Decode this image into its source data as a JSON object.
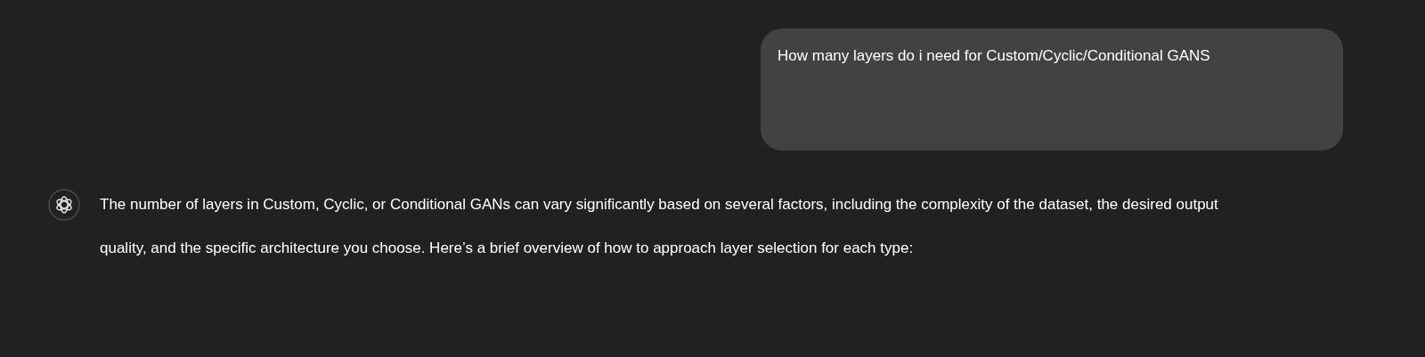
{
  "user_message": "How many layers do i need for Custom/Cyclic/Conditional GANS",
  "assistant_message": "The number of layers in Custom, Cyclic, or Conditional GANs can vary significantly based on several factors, including the complexity of the dataset, the desired output quality, and the specific architecture you choose. Here’s a brief overview of how to approach layer selection for each type:"
}
